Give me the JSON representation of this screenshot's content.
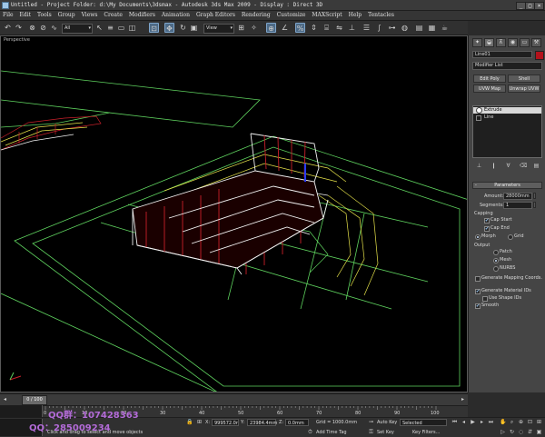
{
  "window": {
    "title": "Untitled    - Project Folder: d:\\My Documents\\3dsmax    - Autodesk 3ds Max  2009     - Display : Direct 3D"
  },
  "menu": [
    "File",
    "Edit",
    "Tools",
    "Group",
    "Views",
    "Create",
    "Modifiers",
    "Animation",
    "Graph Editors",
    "Rendering",
    "Customize",
    "MAXScript",
    "Help",
    "Tentacles"
  ],
  "toolbar": {
    "selection_filter": "All",
    "reference_coord": "View"
  },
  "viewport": {
    "label": "Perspective"
  },
  "command_panel": {
    "object_name": "Line01",
    "object_color": "#b3121b",
    "modifier_list": "Modifier List",
    "buttons": [
      "Edit Poly",
      "Shell",
      "UVW Map",
      "Unwrap UVW"
    ],
    "stack": [
      "Extrude",
      "Line"
    ],
    "parameters": {
      "header": "Parameters",
      "amount_label": "Amount:",
      "amount_value": "28000mm",
      "segments_label": "Segments:",
      "segments_value": "1",
      "capping_label": "Capping",
      "cap_start": "Cap Start",
      "cap_end": "Cap End",
      "morph": "Morph",
      "grid": "Grid",
      "output_label": "Output",
      "patch": "Patch",
      "mesh": "Mesh",
      "nurbs": "NURBS",
      "gen_mapping": "Generate Mapping Coords.",
      "gen_material_ids": "Generate Material IDs",
      "use_shape_ids": "Use Shape IDs",
      "smooth": "Smooth"
    }
  },
  "timeslider": {
    "frame": "0 / 100"
  },
  "trackbar": {
    "ticks": [
      "0",
      "10",
      "20",
      "30",
      "40",
      "50",
      "60",
      "70",
      "80",
      "90",
      "100"
    ]
  },
  "status": {
    "x_label": "X:",
    "x_value": "999572.0r",
    "y_label": "Y:",
    "y_value": "23984.4mm",
    "z_label": "Z:",
    "z_value": "0.0mm",
    "grid": "Grid = 1000.0mm",
    "prompt": "Click and drag to select and move objects",
    "add_time_tag": "Add Time Tag",
    "auto_key": "Auto Key",
    "set_key": "Set Key",
    "key_filters": "Key Filters...",
    "selected": "Selected"
  },
  "watermark": {
    "line1": "QQ群：107428363",
    "line2": "QQ：285009234"
  },
  "colors": {
    "wire_green": "#5fd35f",
    "wire_yellow": "#e6e24a",
    "wire_red": "#c8202a",
    "wire_white": "#f2f2f2",
    "wire_blue": "#2a3cff"
  }
}
